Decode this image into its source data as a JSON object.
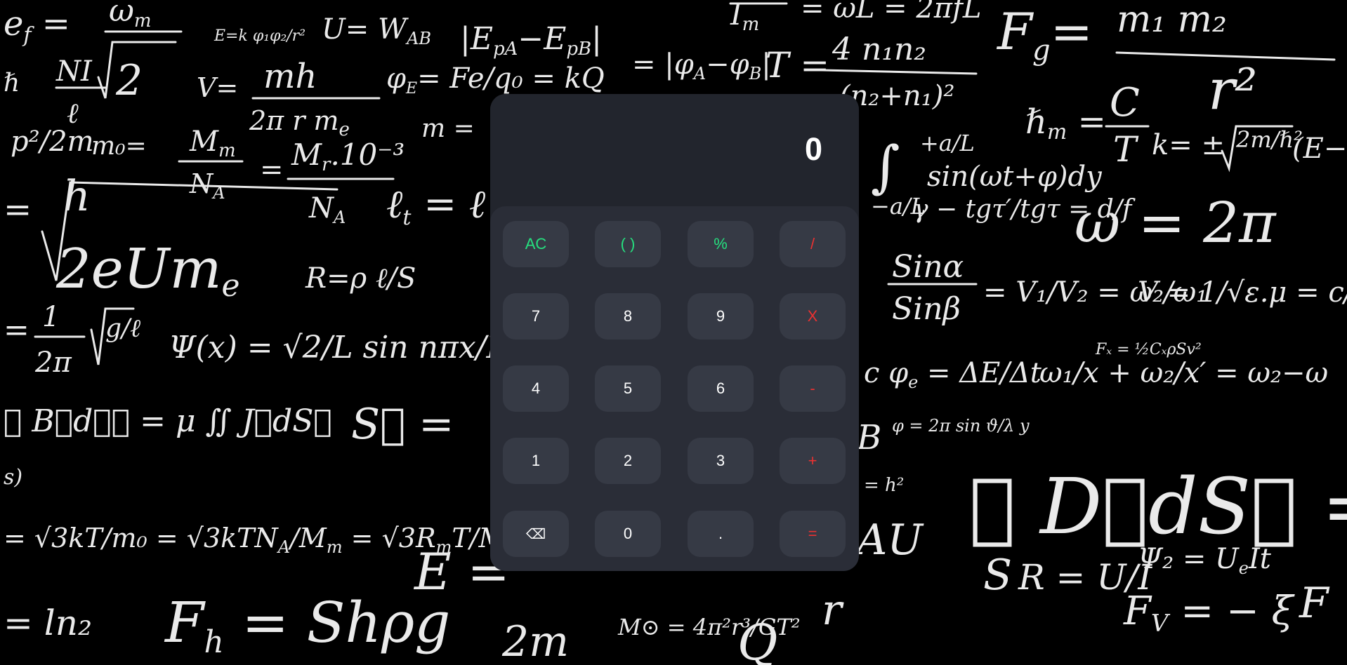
{
  "calculator": {
    "display_value": "0",
    "keys": [
      {
        "label": "AC",
        "name": "clear-button",
        "kind": "fn"
      },
      {
        "label": "( )",
        "name": "parentheses-button",
        "kind": "fn"
      },
      {
        "label": "%",
        "name": "percent-button",
        "kind": "fn"
      },
      {
        "label": "/",
        "name": "divide-button",
        "kind": "op"
      },
      {
        "label": "7",
        "name": "digit-7-button",
        "kind": "num"
      },
      {
        "label": "8",
        "name": "digit-8-button",
        "kind": "num"
      },
      {
        "label": "9",
        "name": "digit-9-button",
        "kind": "num"
      },
      {
        "label": "X",
        "name": "multiply-button",
        "kind": "op"
      },
      {
        "label": "4",
        "name": "digit-4-button",
        "kind": "num"
      },
      {
        "label": "5",
        "name": "digit-5-button",
        "kind": "num"
      },
      {
        "label": "6",
        "name": "digit-6-button",
        "kind": "num"
      },
      {
        "label": "-",
        "name": "subtract-button",
        "kind": "op"
      },
      {
        "label": "1",
        "name": "digit-1-button",
        "kind": "num"
      },
      {
        "label": "2",
        "name": "digit-2-button",
        "kind": "num"
      },
      {
        "label": "3",
        "name": "digit-3-button",
        "kind": "num"
      },
      {
        "label": "+",
        "name": "add-button",
        "kind": "op"
      },
      {
        "label": "⌫",
        "name": "backspace-button",
        "kind": "back",
        "icon": "backspace-icon"
      },
      {
        "label": "0",
        "name": "digit-0-button",
        "kind": "num"
      },
      {
        "label": ".",
        "name": "decimal-button",
        "kind": "num"
      },
      {
        "label": "=",
        "name": "equals-button",
        "kind": "op"
      }
    ]
  },
  "colors": {
    "body_background": "#22252d",
    "keypad_background": "#2a2d37",
    "key_background": "#363a45",
    "function_key_text": "#26e07f",
    "operator_key_text": "#eb3131",
    "number_key_text": "#ffffff"
  },
  "background": {
    "description_icon": "chalkboard-formulas-icon"
  }
}
